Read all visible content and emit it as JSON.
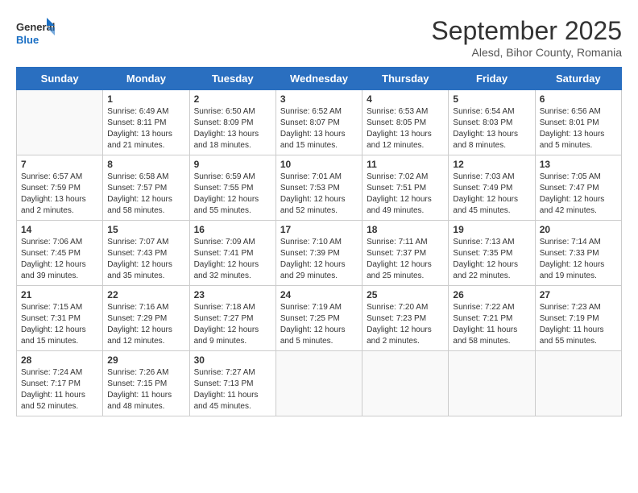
{
  "header": {
    "logo_line1": "General",
    "logo_line2": "Blue",
    "month": "September 2025",
    "location": "Alesd, Bihor County, Romania"
  },
  "days_of_week": [
    "Sunday",
    "Monday",
    "Tuesday",
    "Wednesday",
    "Thursday",
    "Friday",
    "Saturday"
  ],
  "weeks": [
    [
      {
        "day": "",
        "empty": true
      },
      {
        "day": "1",
        "sunrise": "Sunrise: 6:49 AM",
        "sunset": "Sunset: 8:11 PM",
        "daylight": "Daylight: 13 hours and 21 minutes."
      },
      {
        "day": "2",
        "sunrise": "Sunrise: 6:50 AM",
        "sunset": "Sunset: 8:09 PM",
        "daylight": "Daylight: 13 hours and 18 minutes."
      },
      {
        "day": "3",
        "sunrise": "Sunrise: 6:52 AM",
        "sunset": "Sunset: 8:07 PM",
        "daylight": "Daylight: 13 hours and 15 minutes."
      },
      {
        "day": "4",
        "sunrise": "Sunrise: 6:53 AM",
        "sunset": "Sunset: 8:05 PM",
        "daylight": "Daylight: 13 hours and 12 minutes."
      },
      {
        "day": "5",
        "sunrise": "Sunrise: 6:54 AM",
        "sunset": "Sunset: 8:03 PM",
        "daylight": "Daylight: 13 hours and 8 minutes."
      },
      {
        "day": "6",
        "sunrise": "Sunrise: 6:56 AM",
        "sunset": "Sunset: 8:01 PM",
        "daylight": "Daylight: 13 hours and 5 minutes."
      }
    ],
    [
      {
        "day": "7",
        "sunrise": "Sunrise: 6:57 AM",
        "sunset": "Sunset: 7:59 PM",
        "daylight": "Daylight: 13 hours and 2 minutes."
      },
      {
        "day": "8",
        "sunrise": "Sunrise: 6:58 AM",
        "sunset": "Sunset: 7:57 PM",
        "daylight": "Daylight: 12 hours and 58 minutes."
      },
      {
        "day": "9",
        "sunrise": "Sunrise: 6:59 AM",
        "sunset": "Sunset: 7:55 PM",
        "daylight": "Daylight: 12 hours and 55 minutes."
      },
      {
        "day": "10",
        "sunrise": "Sunrise: 7:01 AM",
        "sunset": "Sunset: 7:53 PM",
        "daylight": "Daylight: 12 hours and 52 minutes."
      },
      {
        "day": "11",
        "sunrise": "Sunrise: 7:02 AM",
        "sunset": "Sunset: 7:51 PM",
        "daylight": "Daylight: 12 hours and 49 minutes."
      },
      {
        "day": "12",
        "sunrise": "Sunrise: 7:03 AM",
        "sunset": "Sunset: 7:49 PM",
        "daylight": "Daylight: 12 hours and 45 minutes."
      },
      {
        "day": "13",
        "sunrise": "Sunrise: 7:05 AM",
        "sunset": "Sunset: 7:47 PM",
        "daylight": "Daylight: 12 hours and 42 minutes."
      }
    ],
    [
      {
        "day": "14",
        "sunrise": "Sunrise: 7:06 AM",
        "sunset": "Sunset: 7:45 PM",
        "daylight": "Daylight: 12 hours and 39 minutes."
      },
      {
        "day": "15",
        "sunrise": "Sunrise: 7:07 AM",
        "sunset": "Sunset: 7:43 PM",
        "daylight": "Daylight: 12 hours and 35 minutes."
      },
      {
        "day": "16",
        "sunrise": "Sunrise: 7:09 AM",
        "sunset": "Sunset: 7:41 PM",
        "daylight": "Daylight: 12 hours and 32 minutes."
      },
      {
        "day": "17",
        "sunrise": "Sunrise: 7:10 AM",
        "sunset": "Sunset: 7:39 PM",
        "daylight": "Daylight: 12 hours and 29 minutes."
      },
      {
        "day": "18",
        "sunrise": "Sunrise: 7:11 AM",
        "sunset": "Sunset: 7:37 PM",
        "daylight": "Daylight: 12 hours and 25 minutes."
      },
      {
        "day": "19",
        "sunrise": "Sunrise: 7:13 AM",
        "sunset": "Sunset: 7:35 PM",
        "daylight": "Daylight: 12 hours and 22 minutes."
      },
      {
        "day": "20",
        "sunrise": "Sunrise: 7:14 AM",
        "sunset": "Sunset: 7:33 PM",
        "daylight": "Daylight: 12 hours and 19 minutes."
      }
    ],
    [
      {
        "day": "21",
        "sunrise": "Sunrise: 7:15 AM",
        "sunset": "Sunset: 7:31 PM",
        "daylight": "Daylight: 12 hours and 15 minutes."
      },
      {
        "day": "22",
        "sunrise": "Sunrise: 7:16 AM",
        "sunset": "Sunset: 7:29 PM",
        "daylight": "Daylight: 12 hours and 12 minutes."
      },
      {
        "day": "23",
        "sunrise": "Sunrise: 7:18 AM",
        "sunset": "Sunset: 7:27 PM",
        "daylight": "Daylight: 12 hours and 9 minutes."
      },
      {
        "day": "24",
        "sunrise": "Sunrise: 7:19 AM",
        "sunset": "Sunset: 7:25 PM",
        "daylight": "Daylight: 12 hours and 5 minutes."
      },
      {
        "day": "25",
        "sunrise": "Sunrise: 7:20 AM",
        "sunset": "Sunset: 7:23 PM",
        "daylight": "Daylight: 12 hours and 2 minutes."
      },
      {
        "day": "26",
        "sunrise": "Sunrise: 7:22 AM",
        "sunset": "Sunset: 7:21 PM",
        "daylight": "Daylight: 11 hours and 58 minutes."
      },
      {
        "day": "27",
        "sunrise": "Sunrise: 7:23 AM",
        "sunset": "Sunset: 7:19 PM",
        "daylight": "Daylight: 11 hours and 55 minutes."
      }
    ],
    [
      {
        "day": "28",
        "sunrise": "Sunrise: 7:24 AM",
        "sunset": "Sunset: 7:17 PM",
        "daylight": "Daylight: 11 hours and 52 minutes."
      },
      {
        "day": "29",
        "sunrise": "Sunrise: 7:26 AM",
        "sunset": "Sunset: 7:15 PM",
        "daylight": "Daylight: 11 hours and 48 minutes."
      },
      {
        "day": "30",
        "sunrise": "Sunrise: 7:27 AM",
        "sunset": "Sunset: 7:13 PM",
        "daylight": "Daylight: 11 hours and 45 minutes."
      },
      {
        "day": "",
        "empty": true
      },
      {
        "day": "",
        "empty": true
      },
      {
        "day": "",
        "empty": true
      },
      {
        "day": "",
        "empty": true
      }
    ]
  ]
}
